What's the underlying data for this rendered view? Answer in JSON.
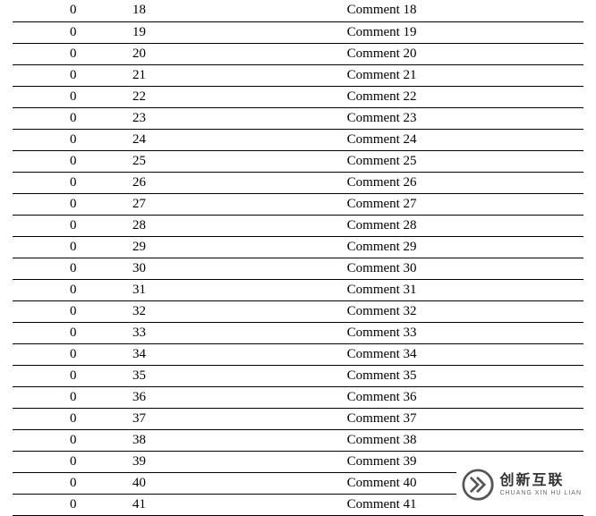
{
  "rows": [
    {
      "a": "0",
      "b": "18",
      "c": "Comment 18"
    },
    {
      "a": "0",
      "b": "19",
      "c": "Comment 19"
    },
    {
      "a": "0",
      "b": "20",
      "c": "Comment 20"
    },
    {
      "a": "0",
      "b": "21",
      "c": "Comment 21"
    },
    {
      "a": "0",
      "b": "22",
      "c": "Comment 22"
    },
    {
      "a": "0",
      "b": "23",
      "c": "Comment 23"
    },
    {
      "a": "0",
      "b": "24",
      "c": "Comment 24"
    },
    {
      "a": "0",
      "b": "25",
      "c": "Comment 25"
    },
    {
      "a": "0",
      "b": "26",
      "c": "Comment 26"
    },
    {
      "a": "0",
      "b": "27",
      "c": "Comment 27"
    },
    {
      "a": "0",
      "b": "28",
      "c": "Comment 28"
    },
    {
      "a": "0",
      "b": "29",
      "c": "Comment 29"
    },
    {
      "a": "0",
      "b": "30",
      "c": "Comment 30"
    },
    {
      "a": "0",
      "b": "31",
      "c": "Comment 31"
    },
    {
      "a": "0",
      "b": "32",
      "c": "Comment 32"
    },
    {
      "a": "0",
      "b": "33",
      "c": "Comment 33"
    },
    {
      "a": "0",
      "b": "34",
      "c": "Comment 34"
    },
    {
      "a": "0",
      "b": "35",
      "c": "Comment 35"
    },
    {
      "a": "0",
      "b": "36",
      "c": "Comment 36"
    },
    {
      "a": "0",
      "b": "37",
      "c": "Comment 37"
    },
    {
      "a": "0",
      "b": "38",
      "c": "Comment 38"
    },
    {
      "a": "0",
      "b": "39",
      "c": "Comment 39"
    },
    {
      "a": "0",
      "b": "40",
      "c": "Comment 40"
    },
    {
      "a": "0",
      "b": "41",
      "c": "Comment 41"
    }
  ],
  "watermark": {
    "cn": "创新互联",
    "en": "CHUANG XIN HU LIAN"
  }
}
